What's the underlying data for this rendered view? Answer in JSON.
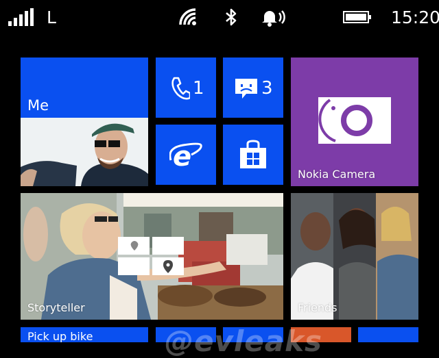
{
  "status_bar": {
    "carrier": "L",
    "time": "15:20",
    "icons": [
      "signal-icon",
      "wifi-icon",
      "bluetooth-icon",
      "ringer-icon",
      "battery-icon"
    ]
  },
  "tiles": {
    "me": {
      "label": "Me"
    },
    "phone": {
      "count": "1"
    },
    "messaging": {
      "count": "3"
    },
    "internet_explorer": {
      "icon": "ie-icon"
    },
    "store": {
      "icon": "store-icon"
    },
    "nokia_camera": {
      "label": "Nokia Camera"
    },
    "storyteller": {
      "label": "Storyteller"
    },
    "friends": {
      "label": "Friends"
    },
    "pick_up_bike": {
      "label": "Pick up bike"
    }
  },
  "watermark": "@evleaks",
  "colors": {
    "accent": "#0a50f0",
    "camera": "#7d3ca8",
    "background": "#000000"
  }
}
